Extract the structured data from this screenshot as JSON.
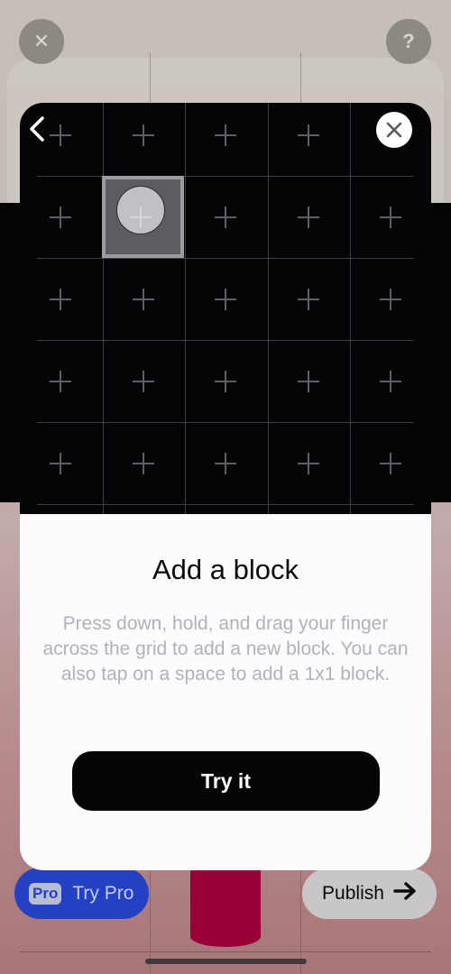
{
  "top_bar": {
    "close_icon": "close-icon",
    "help_label": "?"
  },
  "grid": {
    "columns": 5,
    "rows": 5,
    "selected_cell": {
      "row": 2,
      "col": 2
    },
    "cell_icon": "plus-icon"
  },
  "modal": {
    "back_icon": "chevron-left-icon",
    "close_icon": "close-icon",
    "title": "Add a block",
    "description": "Press down, hold, and drag your finger across the grid to add a new block. You can also tap on a space to add a 1x1 block.",
    "primary_button": "Try it"
  },
  "bottom_bar": {
    "pro_badge": "Pro",
    "try_pro_label": "Try Pro",
    "publish_label": "Publish",
    "publish_icon": "arrow-right-icon"
  },
  "colors": {
    "accent_blue": "#2441c3",
    "dark": "#050407",
    "block_red": "#9a0038"
  }
}
